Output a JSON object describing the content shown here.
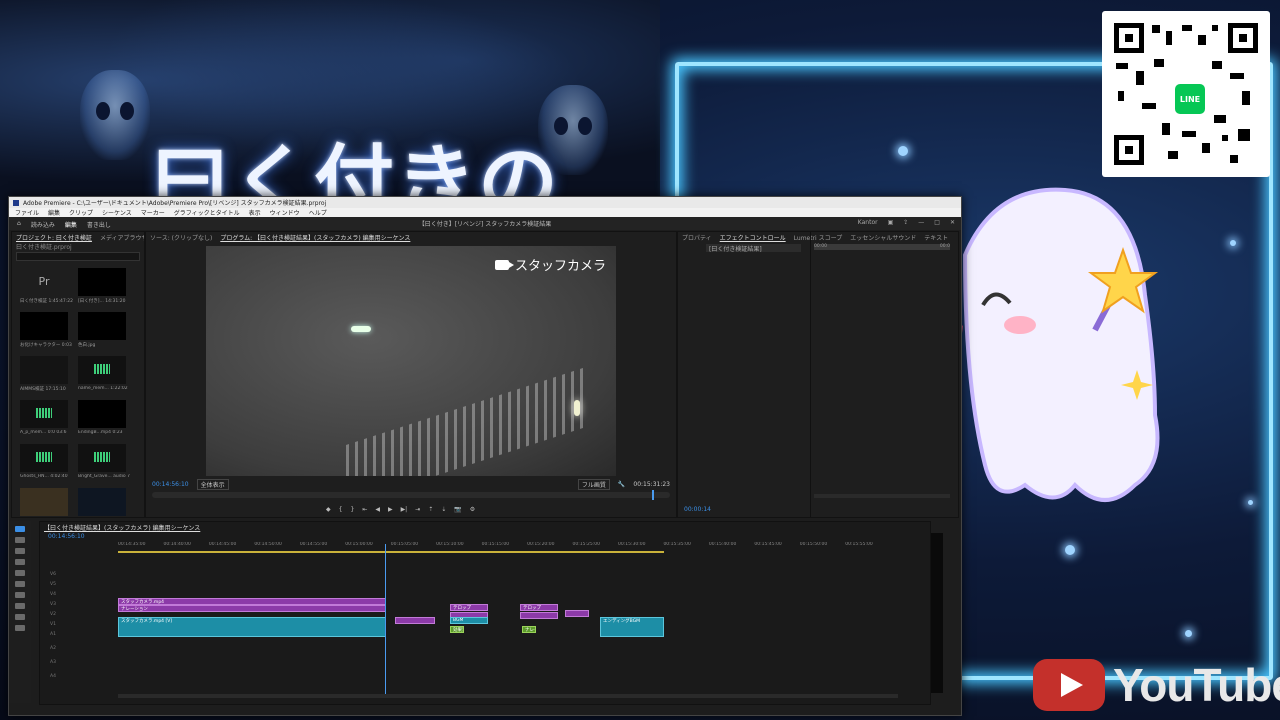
{
  "overlay": {
    "title_text": "曰く付きの",
    "qr_badge": "LINE",
    "youtube_text": "YouTube"
  },
  "premiere": {
    "titlebar": "Adobe Premiere - C:\\ユーザー\\ドキュメント\\Adobe\\Premiere Pro\\[リベンジ] スタッフカメラ検証結果.prproj",
    "menu": [
      "ファイル",
      "編集",
      "クリップ",
      "シーケンス",
      "マーカー",
      "グラフィックとタイトル",
      "表示",
      "ウィンドウ",
      "ヘルプ"
    ],
    "workspace_tabs": [
      "読み込み",
      "編集",
      "書き出し"
    ],
    "workspace_title": "【曰く付き】[リベンジ] スタッフカメラ検証結果",
    "workspace_right": "Kantor",
    "project_panel": {
      "tabs": [
        "プロジェクト: 曰く付き検証",
        "メディアブラウザー",
        "ライブラリ"
      ],
      "path": "曰く付き検証.prproj",
      "items": [
        {
          "name": "曰く付き検証",
          "dur": "1:45:47:22",
          "type": "pr"
        },
        {
          "name": "[曰く付き]...",
          "dur": "14:31:20",
          "type": "black"
        },
        {
          "name": "お化けキャラクター",
          "dur": "0:03",
          "type": "black"
        },
        {
          "name": "色白.jpg",
          "dur": "",
          "type": "black"
        },
        {
          "name": "AIMMS検証",
          "dur": "17:15:10",
          "type": "black"
        },
        {
          "name": "name_mem...",
          "dur": "1:22:02",
          "type": "audio"
        },
        {
          "name": "A_p_mem...",
          "dur": "0:0 03:6",
          "type": "audio"
        },
        {
          "name": "EndingB...mp4",
          "dur": "0:23",
          "type": "black"
        },
        {
          "name": "Ghosts_HN...",
          "dur": "4:02:40",
          "type": "audio"
        },
        {
          "name": "Bright_Grave...",
          "dur": "audio 7",
          "type": "audio"
        }
      ]
    },
    "source_tabs": [
      "ソース: (クリップなし)",
      "プログラム: 【曰く付き検証結果】(スタッフカメラ) 編集用シーケンス"
    ],
    "program": {
      "camera_label": "スタッフカメラ",
      "timecode_current": "00:14:56:10",
      "zoom": "全体表示",
      "quality": "フル画質",
      "timecode_duration": "00:15:31:23"
    },
    "effects_panel": {
      "tabs": [
        "プロパティ",
        "エフェクトコントロール",
        "Lumetri スコープ",
        "エッセンシャルサウンド",
        "テキスト"
      ],
      "clip_name": "[曰く付き検証結果]",
      "time_start": "00:00",
      "time_end": "00:0",
      "bottom_tc": "00:00:14"
    },
    "timeline": {
      "sequence_tab": "【曰く付き検証結果】(スタッフカメラ) 編集用シーケンス",
      "timecode": "00:14:56:10",
      "ruler": [
        "00:14:35:00",
        "00:14:40:00",
        "00:14:45:00",
        "00:14:50:00",
        "00:14:55:00",
        "00:15:00:00",
        "00:15:05:00",
        "00:15:10:00",
        "00:15:15:00",
        "00:15:20:00",
        "00:15:25:00",
        "00:15:30:00",
        "00:15:35:00",
        "00:15:40:00",
        "00:15:45:00",
        "00:15:50:00",
        "00:15:55:00"
      ],
      "track_labels": [
        "V6",
        "V5",
        "V4",
        "V3",
        "V2",
        "V1",
        "A1",
        "A2",
        "A3",
        "A4",
        "A5",
        "A6"
      ],
      "clips": {
        "v_main": "スタッフカメラ.mp4",
        "v_sub": "ナレーション",
        "v_title1": "テロップ",
        "v_title2": "テロップ",
        "a_main": "スタッフカメラ.mp4 [V]",
        "a_2": "効果音",
        "a_3": "ナレーション",
        "a_4": "BGM",
        "a_end": "エンディングBGM"
      }
    }
  }
}
